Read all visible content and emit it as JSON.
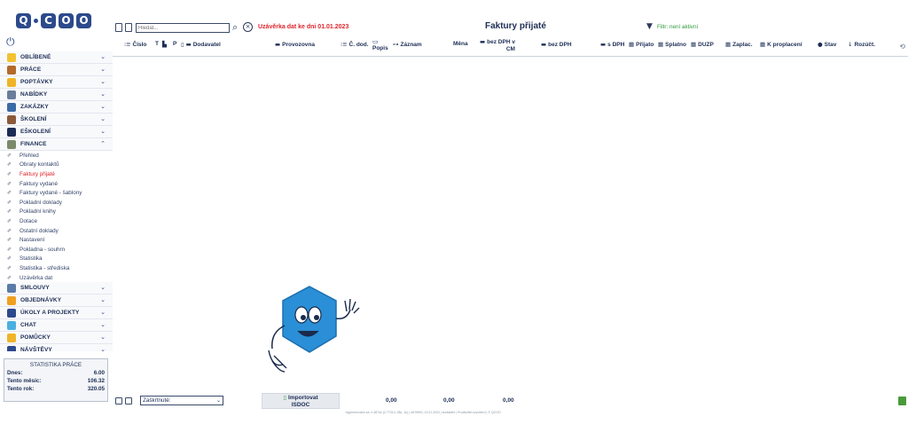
{
  "app": {
    "logo_letters": [
      "Q",
      "C",
      "O",
      "O"
    ],
    "power_icon": "power-icon"
  },
  "sidebar": {
    "sections_top": [
      {
        "label": "OBLÍBENÉ",
        "icon": "star-icon",
        "color": "#f2c230",
        "expanded": false
      },
      {
        "label": "PRÁCE",
        "icon": "briefcase-icon",
        "color": "#b36a2b",
        "expanded": false
      },
      {
        "label": "POPTÁVKY",
        "icon": "lightbulb-icon",
        "color": "#f0b428",
        "expanded": false
      },
      {
        "label": "NABÍDKY",
        "icon": "clipboard-icon",
        "color": "#6a7d9a",
        "expanded": false
      },
      {
        "label": "ZAKÁZKY",
        "icon": "monitor-icon",
        "color": "#3a6aa8",
        "expanded": false
      },
      {
        "label": "ŠKOLENÍ",
        "icon": "whiteboard-icon",
        "color": "#8a5a3a",
        "expanded": false
      },
      {
        "label": "eŠKOLENÍ",
        "icon": "graduation-cap-icon",
        "color": "#1c2d55",
        "expanded": false
      },
      {
        "label": "FINANCE",
        "icon": "money-icon",
        "color": "#7a8a6a",
        "expanded": true
      }
    ],
    "finance_items": [
      "Přehled",
      "Obraty kontaktů",
      "Faktury přijaté",
      "Faktury vydané",
      "Faktury vydané - šablony",
      "Pokladní doklady",
      "Pokladní knihy",
      "Dotace",
      "Ostatní doklady",
      "Nastavení",
      "Pokladna - souhrn",
      "Statistika",
      "Statistika - střediska",
      "Uzávěrka dat"
    ],
    "active_item": "Faktury přijaté",
    "sections_bottom": [
      {
        "label": "SMLOUVY",
        "icon": "handshake-icon",
        "color": "#5a7aa8",
        "expanded": false
      },
      {
        "label": "OBJEDNÁVKY",
        "icon": "cart-icon",
        "color": "#f0a020",
        "expanded": false
      },
      {
        "label": "ÚKOLY A PROJEKTY",
        "icon": "checkbox-icon",
        "color": "#2c4a8c",
        "expanded": false
      },
      {
        "label": "CHAT",
        "icon": "chat-icon",
        "color": "#4ab0e0",
        "expanded": false
      },
      {
        "label": "POMŮCKY",
        "icon": "tools-icon",
        "color": "#f0b428",
        "expanded": false
      },
      {
        "label": "NÁVŠTĚVY",
        "icon": "visitor-icon",
        "color": "#2c4a8c",
        "expanded": false
      }
    ]
  },
  "stats": {
    "title": "STATISTIKA PRÁCE",
    "rows": [
      {
        "label": "Dnes:",
        "value": "6.00"
      },
      {
        "label": "Tento měsíc:",
        "value": "106.32"
      },
      {
        "label": "Tento rok:",
        "value": "320.05"
      }
    ]
  },
  "toolbar": {
    "search_placeholder": "Hledat...",
    "closing_notice": "Uzávěrka dat ke dni 01.01.2023",
    "page_title": "Faktury přijaté",
    "filter_status": "Filtr: není aktivní"
  },
  "columns": {
    "number": "Číslo",
    "type": "T",
    "p": "P",
    "supplier": "Dodavatel",
    "branch": "Provozovna",
    "supplier_no": "Č. dod.",
    "description": "Popis",
    "record": "Záznam",
    "currency": "Měna",
    "without_vat_cm_1": "bez DPH v",
    "without_vat_cm_2": "CM",
    "without_vat": "bez DPH",
    "with_vat": "s DPH",
    "received": "Přijato",
    "due": "Splatno",
    "duzp": "DUZP",
    "paid": "Zaplac.",
    "to_pay": "K proplacení",
    "status": "Stav",
    "split": "Rozúčt."
  },
  "bottom": {
    "selection_value": "Zaškrtnuté:",
    "import_label_1": "Importovat",
    "import_label_2": "ISDOC",
    "totals": [
      "0,00",
      "0,00",
      "0,00"
    ]
  },
  "footer": "Vygenerováno za: 0.3874s (2.77014, 08s, 1k) | uf19999 | 13.01.2024 | kontaktér | Prodlužitel urychlení | © QCOO"
}
